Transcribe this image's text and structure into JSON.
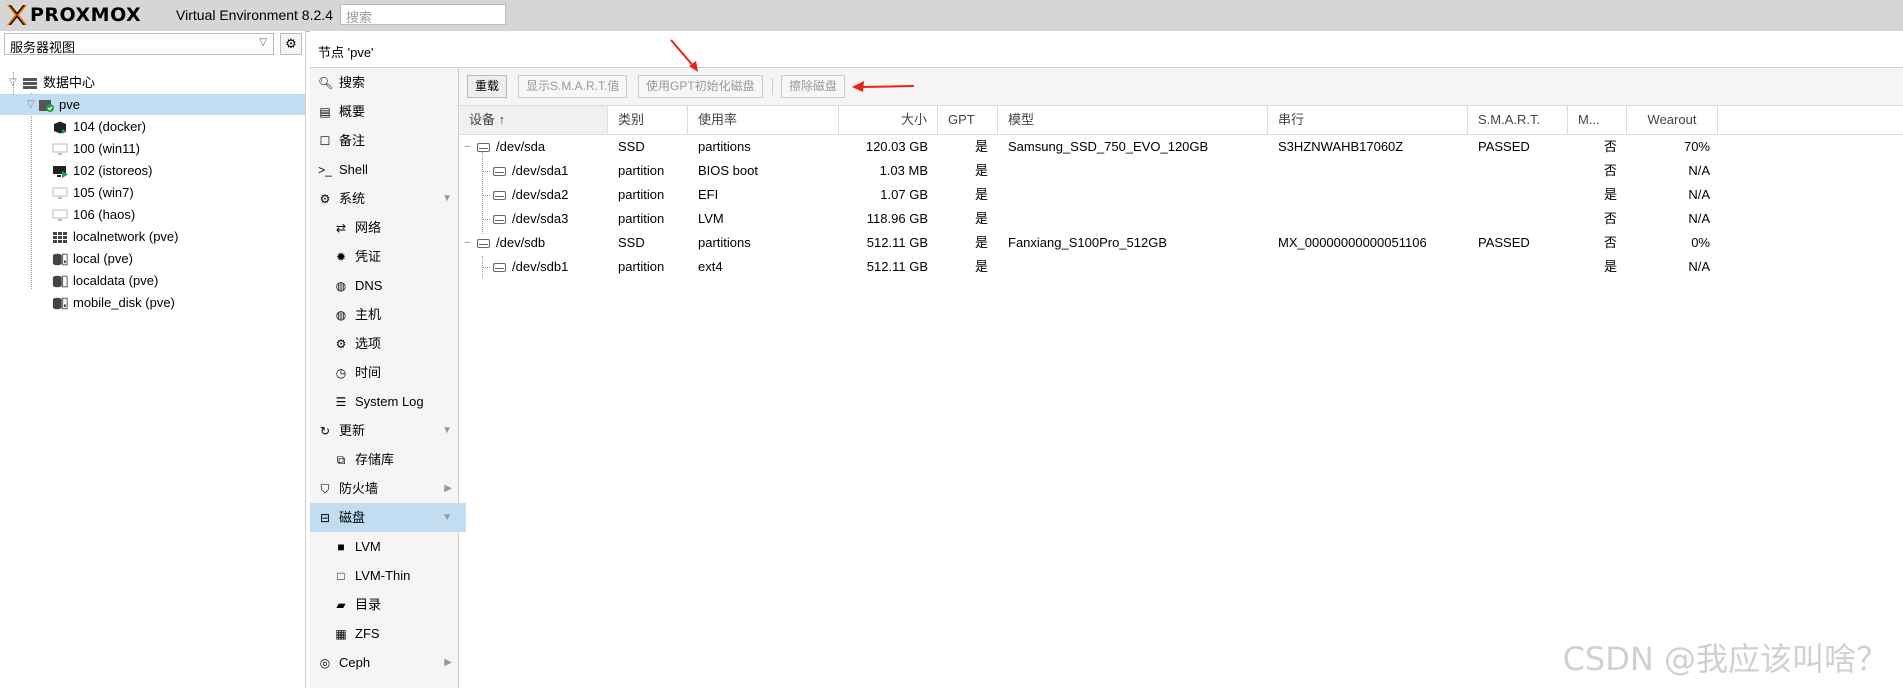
{
  "header": {
    "brand": "PROXMOX",
    "version": "Virtual Environment 8.2.4",
    "search_placeholder": "搜索"
  },
  "sidebar": {
    "view_selector": "服务器视图",
    "tree": [
      {
        "label": "数据中心",
        "icon": "datacenter-icon",
        "level": 0
      },
      {
        "label": "pve",
        "icon": "node-icon",
        "level": 1,
        "selected": true
      },
      {
        "label": "104 (docker)",
        "icon": "container-icon",
        "level": 2
      },
      {
        "label": "100 (win11)",
        "icon": "vm-icon",
        "level": 2
      },
      {
        "label": "102 (istoreos)",
        "icon": "vm-running-icon",
        "level": 2
      },
      {
        "label": "105 (win7)",
        "icon": "vm-icon",
        "level": 2
      },
      {
        "label": "106 (haos)",
        "icon": "vm-icon",
        "level": 2
      },
      {
        "label": "localnetwork (pve)",
        "icon": "network-icon",
        "level": 2
      },
      {
        "label": "local (pve)",
        "icon": "storage-icon",
        "level": 2
      },
      {
        "label": "localdata (pve)",
        "icon": "storage-icon",
        "level": 2
      },
      {
        "label": "mobile_disk (pve)",
        "icon": "storage-icon",
        "level": 2
      }
    ]
  },
  "breadcrumb": "节点 'pve'",
  "nav": [
    {
      "label": "搜索",
      "icon": "search-icon",
      "sub": false
    },
    {
      "label": "概要",
      "icon": "summary-icon",
      "sub": false
    },
    {
      "label": "备注",
      "icon": "notes-icon",
      "sub": false
    },
    {
      "label": "Shell",
      "icon": "shell-icon",
      "sub": false
    },
    {
      "label": "系统",
      "icon": "gears-icon",
      "sub": false,
      "caret": "down"
    },
    {
      "label": "网络",
      "icon": "network-icon",
      "sub": true
    },
    {
      "label": "凭证",
      "icon": "certificate-icon",
      "sub": true
    },
    {
      "label": "DNS",
      "icon": "globe-icon",
      "sub": true
    },
    {
      "label": "主机",
      "icon": "globe-icon",
      "sub": true
    },
    {
      "label": "选项",
      "icon": "gear-icon",
      "sub": true
    },
    {
      "label": "时间",
      "icon": "clock-icon",
      "sub": true
    },
    {
      "label": "System Log",
      "icon": "list-icon",
      "sub": true
    },
    {
      "label": "更新",
      "icon": "refresh-icon",
      "sub": false,
      "caret": "down"
    },
    {
      "label": "存储库",
      "icon": "repository-icon",
      "sub": true
    },
    {
      "label": "防火墙",
      "icon": "shield-icon",
      "sub": false,
      "caret": "right"
    },
    {
      "label": "磁盘",
      "icon": "disk-icon",
      "sub": false,
      "caret": "down",
      "selected": true
    },
    {
      "label": "LVM",
      "icon": "lvm-icon",
      "sub": true
    },
    {
      "label": "LVM-Thin",
      "icon": "lvm-thin-icon",
      "sub": true
    },
    {
      "label": "目录",
      "icon": "folder-icon",
      "sub": true
    },
    {
      "label": "ZFS",
      "icon": "zfs-icon",
      "sub": true
    },
    {
      "label": "Ceph",
      "icon": "ceph-icon",
      "sub": false,
      "caret": "right"
    }
  ],
  "toolbar": {
    "reload": "重载",
    "smart": "显示S.M.A.R.T.值",
    "init_gpt": "使用GPT初始化磁盘",
    "wipe": "擦除磁盘"
  },
  "columns": [
    "设备 ↑",
    "类别",
    "使用率",
    "大小",
    "GPT",
    "模型",
    "串行",
    "S.M.A.R.T.",
    "M...",
    "Wearout"
  ],
  "disks": [
    {
      "device": "/dev/sda",
      "type": "SSD",
      "usage": "partitions",
      "size": "120.03 GB",
      "gpt": "是",
      "model": "Samsung_SSD_750_EVO_120GB",
      "serial": "S3HZNWAHB17060Z",
      "smart": "PASSED",
      "mounted": "否",
      "wearout": "70%",
      "level": 0
    },
    {
      "device": "/dev/sda1",
      "type": "partition",
      "usage": "BIOS boot",
      "size": "1.03 MB",
      "gpt": "是",
      "model": "",
      "serial": "",
      "smart": "",
      "mounted": "否",
      "wearout": "N/A",
      "level": 1
    },
    {
      "device": "/dev/sda2",
      "type": "partition",
      "usage": "EFI",
      "size": "1.07 GB",
      "gpt": "是",
      "model": "",
      "serial": "",
      "smart": "",
      "mounted": "是",
      "wearout": "N/A",
      "level": 1
    },
    {
      "device": "/dev/sda3",
      "type": "partition",
      "usage": "LVM",
      "size": "118.96 GB",
      "gpt": "是",
      "model": "",
      "serial": "",
      "smart": "",
      "mounted": "否",
      "wearout": "N/A",
      "level": 1
    },
    {
      "device": "/dev/sdb",
      "type": "SSD",
      "usage": "partitions",
      "size": "512.11 GB",
      "gpt": "是",
      "model": "Fanxiang_S100Pro_512GB",
      "serial": "MX_00000000000051106",
      "smart": "PASSED",
      "mounted": "否",
      "wearout": "0%",
      "level": 0
    },
    {
      "device": "/dev/sdb1",
      "type": "partition",
      "usage": "ext4",
      "size": "512.11 GB",
      "gpt": "是",
      "model": "",
      "serial": "",
      "smart": "",
      "mounted": "是",
      "wearout": "N/A",
      "level": 1
    }
  ],
  "watermark": "CSDN @我应该叫啥？",
  "colors": {
    "selection": "#c2ddf2",
    "annotation": "#e8221b",
    "logo_orange": "#e57000"
  }
}
